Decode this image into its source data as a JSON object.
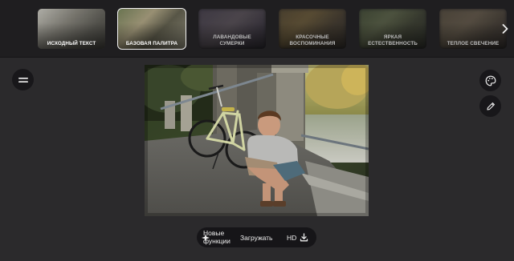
{
  "presets": {
    "items": [
      {
        "label": "ИСХОДНЫЙ ТЕКСТ",
        "state": "normal"
      },
      {
        "label": "БАЗОВАЯ ПАЛИТРА",
        "state": "selected"
      },
      {
        "label": "ЛАВАНДОВЫЕ СУМЕРКИ",
        "state": "dim"
      },
      {
        "label": "КРАСОЧНЫЕ ВОСПОМИНАНИЯ",
        "state": "dim"
      },
      {
        "label": "ЯРКАЯ ЕСТЕСТВЕННОСТЬ",
        "state": "dim"
      },
      {
        "label": "ТЕПЛОЕ СВЕЧЕНИЕ",
        "state": "dim"
      }
    ],
    "next_icon": "chevron-right-icon"
  },
  "side_tools": {
    "menu_icon": "menu-icon",
    "palette_icon": "palette-icon",
    "edit_icon": "pencil-icon"
  },
  "toolbar": {
    "new_features_label": "Новые функции",
    "load_label": "Загружать",
    "hd_label": "HD",
    "hd_icon": "download-icon"
  },
  "colors": {
    "background": "#2b2a2c",
    "strip": "#1f1e20",
    "button": "#18171a",
    "selected_outline": "#f2f2f2"
  }
}
